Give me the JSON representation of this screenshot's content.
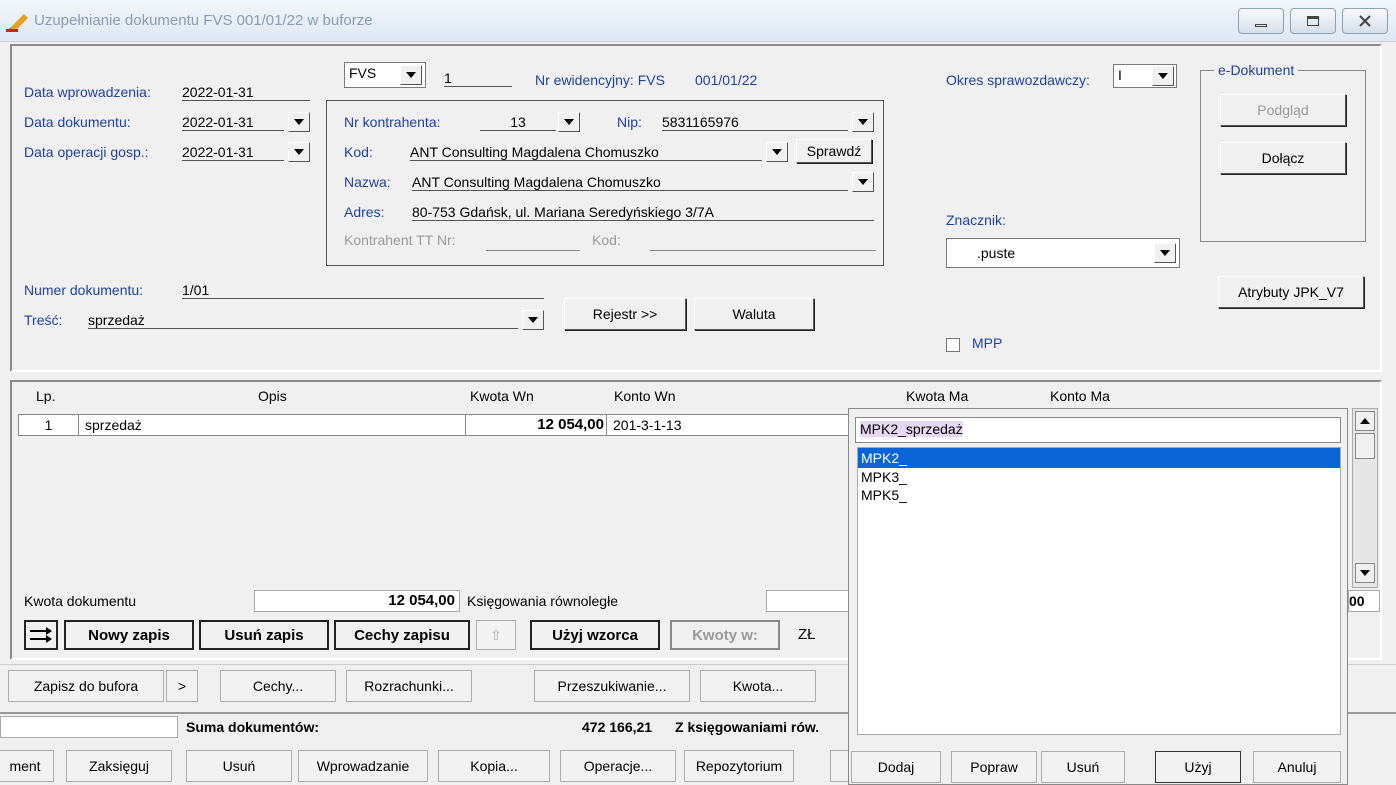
{
  "window": {
    "title": "Uzupełnianie dokumentu FVS 001/01/22 w buforze"
  },
  "header": {
    "data_wprowadzenia_label": "Data wprowadzenia:",
    "data_wprowadzenia": "2022-01-31",
    "data_dokumentu_label": "Data dokumentu:",
    "data_dokumentu": "2022-01-31",
    "data_operacji_label": "Data operacji gosp.:",
    "data_operacji": "2022-01-31",
    "doc_type": "FVS",
    "doc_no": "1",
    "nr_ewid_label": "Nr ewidencyjny: FVS",
    "nr_ewid": "001/01/22",
    "okres_label": "Okres sprawozdawczy:",
    "okres_value": "I",
    "numer_dokumentu_label": "Numer dokumentu:",
    "numer_dokumentu": "1/01",
    "tresc_label": "Treść:",
    "tresc": "sprzedaż",
    "rejestr_btn": "Rejestr >>",
    "waluta_btn": "Waluta",
    "znacznik_label": "Znacznik:",
    "znacznik_value": ".puste",
    "mpp_label": "MPP",
    "edok_legend": "e-Dokument",
    "podglad_btn": "Podgląd",
    "dolacz_btn": "Dołącz",
    "jpk_btn": "Atrybuty JPK_V7"
  },
  "kontrahent": {
    "nr_label": "Nr kontrahenta:",
    "nr": "13",
    "nip_label": "Nip:",
    "nip": "5831165976",
    "kod_label": "Kod:",
    "kod": "ANT Consulting Magdalena Chomuszko",
    "sprawdz_btn": "Sprawdź",
    "nazwa_label": "Nazwa:",
    "nazwa": "ANT Consulting Magdalena Chomuszko",
    "adres_label": "Adres:",
    "adres": "80-753 Gdańsk, ul. Mariana Seredyńskiego 3/7A",
    "tt_nr_label": "Kontrahent TT Nr:",
    "tt_kod_label": "Kod:"
  },
  "table": {
    "columns": [
      "Lp.",
      "Opis",
      "Kwota Wn",
      "Konto Wn",
      "Kwota Ma",
      "Konto Ma"
    ],
    "rows": [
      {
        "lp": "1",
        "opis": "sprzedaż",
        "kwota_wn": "12 054,00",
        "konto_wn": "201-3-1-13"
      }
    ]
  },
  "footer": {
    "kwota_label": "Kwota dokumentu",
    "kwota": "12 054,00",
    "ksiegowania_label": "Księgowania równoległe",
    "ksiegowania_value_partial": "00",
    "nowy_zapis": "Nowy zapis",
    "usun_zapis": "Usuń zapis",
    "cechy_zapisu": "Cechy zapisu",
    "uzyj_wzorca": "Użyj wzorca",
    "kwoty_w": "Kwoty w:",
    "currency": "ZŁ"
  },
  "action_bar": {
    "zapisz": "Zapisz do bufora",
    "more": ">",
    "cechy": "Cechy...",
    "rozrachunki": "Rozrachunki...",
    "przeszukiwanie": "Przeszukiwanie...",
    "kwota": "Kwota..."
  },
  "bottom": {
    "suma_label": "Suma dokumentów:",
    "suma_value": "472 166,21",
    "z_ksieg": "Z księgowaniami rów.",
    "dokument_partial": "ment",
    "zaksieguj": "Zaksięguj",
    "usun": "Usuń",
    "wprowadzanie": "Wprowadzanie",
    "kopia": "Kopia...",
    "operacje": "Operacje...",
    "repozytorium": "Repozytorium"
  },
  "popup": {
    "input_value": "MPK2_sprzedaż",
    "items": [
      "MPK2_",
      "MPK3_",
      "MPK5_"
    ],
    "selected_index": 0,
    "dodaj": "Dodaj",
    "popraw": "Popraw",
    "usun": "Usuń",
    "uzyj": "Użyj",
    "anuluj": "Anuluj"
  },
  "colors": {
    "label_blue": "#1f3f9f",
    "selection": "#0a64d6"
  }
}
